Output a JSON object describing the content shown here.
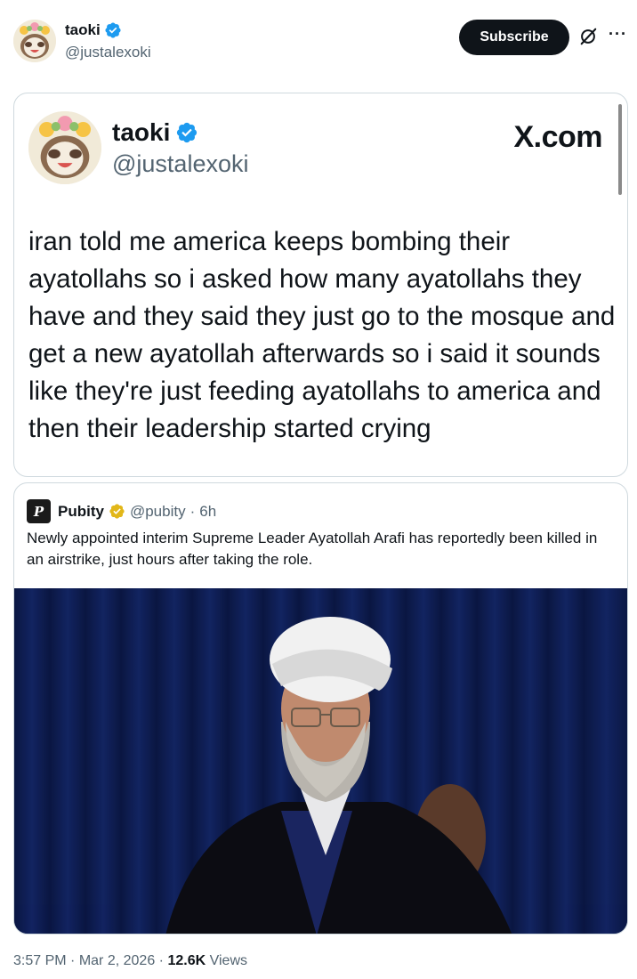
{
  "author": {
    "name": "taoki",
    "handle": "@justalexoki"
  },
  "header": {
    "subscribe_label": "Subscribe",
    "more_label": "···",
    "grok_icon": "grok-icon",
    "verified_color": "#1d9bf0"
  },
  "embedded_screenshot": {
    "name": "taoki",
    "handle": "@justalexoki",
    "brand": "X.com",
    "text": "iran told me america keeps bombing their ayatollahs so i asked how many ayatollahs they have and they said they just go to the mosque and get a new ayatollah afterwards so i said it sounds like they're just feeding ayatollahs to america and then their leadership started crying"
  },
  "quote": {
    "logo_letter": "P",
    "name": "Pubity",
    "handle": "@pubity",
    "separator": "·",
    "time": "6h",
    "text": "Newly appointed interim Supreme Leader Ayatollah Arafi has reportedly been killed in an airstrike, just hours after taking the role.",
    "verified_color": "#e2b719"
  },
  "footer": {
    "time": "3:57 PM",
    "sep1": "·",
    "date": "Mar 2, 2026",
    "sep2": "·",
    "views_count": "12.6K",
    "views_label": "Views"
  }
}
